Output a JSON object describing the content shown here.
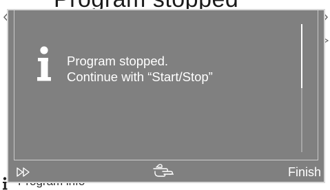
{
  "background": {
    "title": "Program stopped",
    "footer_label": "Program info"
  },
  "dialog": {
    "message_line1": "Program stopped.",
    "message_line2": "Continue with “Start/Stop”",
    "finish_label": "Finish",
    "scroll_position": 0.0,
    "scroll_visible_fraction": 0.5
  },
  "icons": {
    "info": "info-icon",
    "fast_forward": "fast-forward-icon",
    "hand": "pointing-hand-icon"
  },
  "colors": {
    "dialog_bg": "#808080",
    "text": "#ffffff"
  }
}
